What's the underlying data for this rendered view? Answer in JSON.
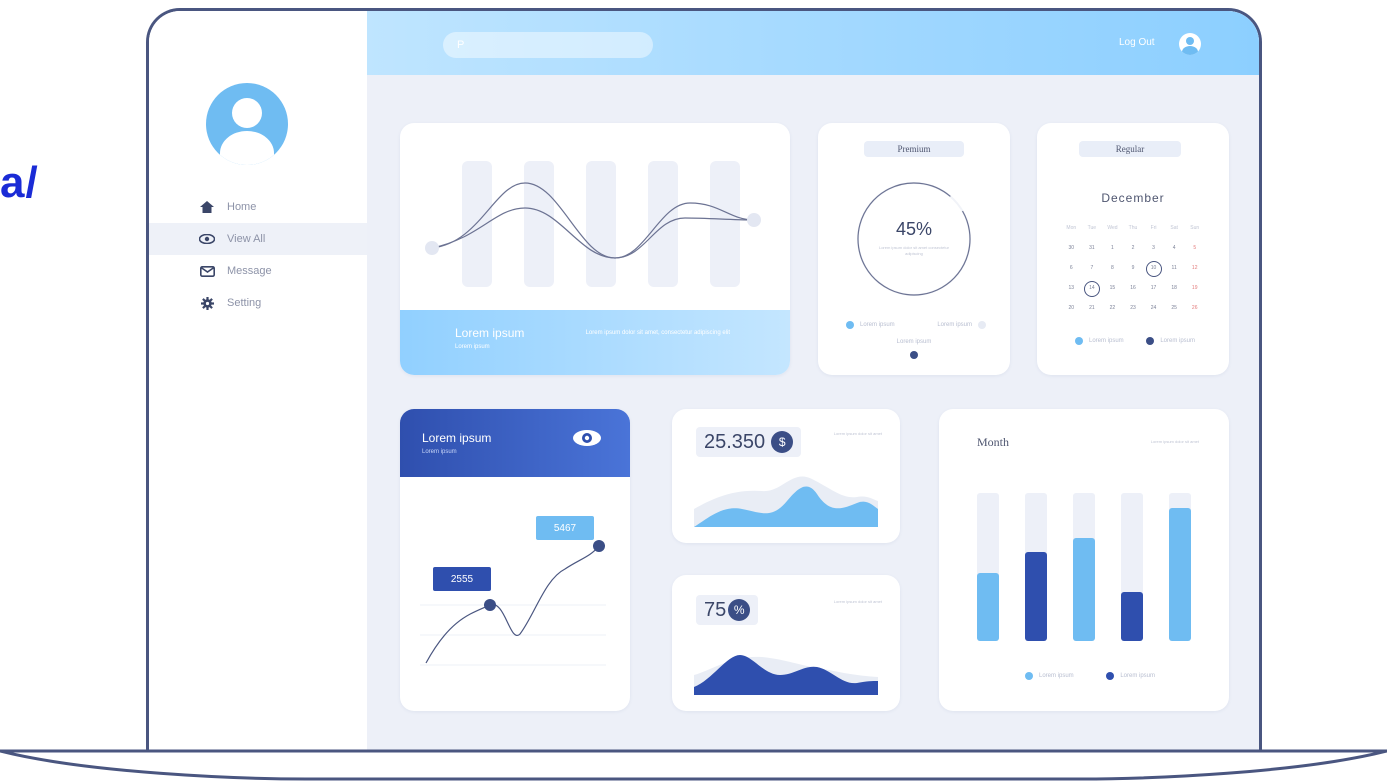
{
  "side_text": "a/",
  "sidebar": {
    "items": [
      {
        "label": "Home",
        "icon": "home-icon"
      },
      {
        "label": "View All",
        "icon": "eye-icon"
      },
      {
        "label": "Message",
        "icon": "mail-icon"
      },
      {
        "label": "Setting",
        "icon": "gear-icon"
      }
    ],
    "active_index": 1
  },
  "topbar": {
    "search_placeholder": "P",
    "logout_label": "Log Out"
  },
  "wave_card": {
    "title": "Lorem ipsum",
    "subtitle": "Lorem ipsum",
    "text": "Lorem ipsum dolor sit amet, consectetur adipiscing elit"
  },
  "premium_card": {
    "label": "Premium",
    "percent": "45%",
    "progress": 0.45,
    "desc": "Lorem ipsum dolor sit amet consectetur adipiscing",
    "legend": [
      "Lorem ipsum",
      "Lorem ipsum"
    ],
    "footer": "Lorem ipsum"
  },
  "regular_card": {
    "label": "Regular",
    "month": "December",
    "weekdays": [
      "Mon",
      "Tue",
      "Wed",
      "Thu",
      "Fri",
      "Sat",
      "Sun"
    ],
    "days": [
      [
        "30",
        "31",
        "1",
        "2",
        "3",
        "4",
        "5"
      ],
      [
        "6",
        "7",
        "8",
        "9",
        "10",
        "11",
        "12"
      ],
      [
        "13",
        "14",
        "15",
        "16",
        "17",
        "18",
        "19"
      ],
      [
        "20",
        "21",
        "22",
        "23",
        "24",
        "25",
        "26"
      ]
    ],
    "legend": [
      "Lorem ipsum",
      "Lorem ipsum"
    ]
  },
  "line_card": {
    "title": "Lorem ipsum",
    "subtitle": "Lorem ipsum",
    "label_a": "2555",
    "label_b": "5467"
  },
  "value_card": {
    "value": "25.350",
    "currency": "$",
    "note": "Lorem ipsum dolor sit amet"
  },
  "percent_card": {
    "value": "75",
    "unit": "%",
    "note": "Lorem ipsum dolor sit amet"
  },
  "month_card": {
    "title": "Month",
    "note": "Lorem ipsum dolor sit amet",
    "legend": [
      "Lorem ipsum",
      "Lorem ipsum"
    ]
  },
  "colors": {
    "accent_blue": "#6fbcf2",
    "dark_blue": "#2f4fae",
    "navy": "#3b4e86",
    "light_track": "#edf0f8"
  }
}
